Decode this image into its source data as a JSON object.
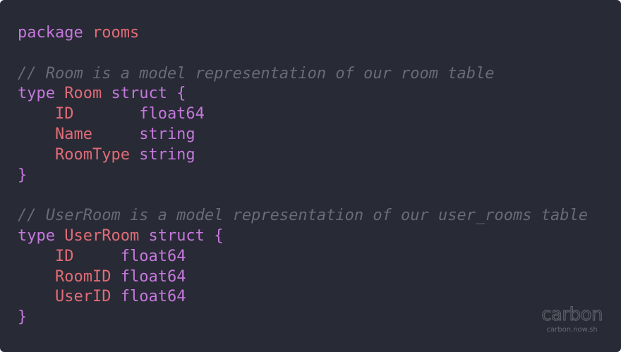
{
  "code": {
    "package_kw": "package",
    "package_name": "rooms",
    "room": {
      "comment": "// Room is a model representation of our room table",
      "type_kw": "type",
      "name": "Room",
      "struct_kw": "struct",
      "open_brace": "{",
      "close_brace": "}",
      "fields": [
        {
          "name": "ID",
          "pad": "       ",
          "type": "float64"
        },
        {
          "name": "Name",
          "pad": "     ",
          "type": "string"
        },
        {
          "name": "RoomType",
          "pad": " ",
          "type": "string"
        }
      ]
    },
    "user_room": {
      "comment": "// UserRoom is a model representation of our user_rooms table",
      "type_kw": "type",
      "name": "UserRoom",
      "struct_kw": "struct",
      "open_brace": "{",
      "close_brace": "}",
      "fields": [
        {
          "name": "ID",
          "pad": "     ",
          "type": "float64"
        },
        {
          "name": "RoomID",
          "pad": " ",
          "type": "float64"
        },
        {
          "name": "UserID",
          "pad": " ",
          "type": "float64"
        }
      ]
    }
  },
  "watermark": {
    "logo": "carbon",
    "url": "carbon.now.sh"
  },
  "colors": {
    "background": "#282a36",
    "keyword": "#c678dd",
    "identifier": "#e06c75",
    "comment": "#6a6a78"
  }
}
